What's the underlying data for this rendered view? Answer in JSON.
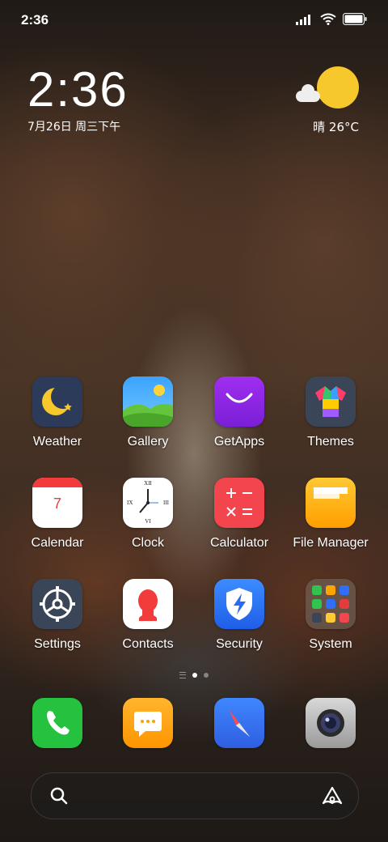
{
  "status_bar": {
    "time": "2:36"
  },
  "clock_widget": {
    "time": "2:36",
    "date": "7月26日 周三下午"
  },
  "weather_widget": {
    "text": "晴 26°C"
  },
  "apps": [
    {
      "label": "Weather"
    },
    {
      "label": "Gallery"
    },
    {
      "label": "GetApps"
    },
    {
      "label": "Themes"
    },
    {
      "label": "Calendar",
      "day": "7"
    },
    {
      "label": "Clock",
      "numerals": [
        "XII",
        "III",
        "VI",
        "IX"
      ]
    },
    {
      "label": "Calculator"
    },
    {
      "label": "File Manager"
    },
    {
      "label": "Settings"
    },
    {
      "label": "Contacts"
    },
    {
      "label": "Security"
    },
    {
      "label": "System"
    }
  ],
  "page_indicator": {
    "current": 1,
    "pages": 2
  },
  "dock": [
    "phone-icon",
    "messages-icon",
    "browser-icon",
    "camera-icon"
  ],
  "colors": {
    "weather_bg": "#2c3b5a",
    "getapps": "#8a2be2",
    "calculator": "#f2454e",
    "file_manager": "#ffb300",
    "security": "#2a6af0",
    "phone": "#24c23f",
    "messages": "#ffa500",
    "browser": "#2f6ef5"
  }
}
